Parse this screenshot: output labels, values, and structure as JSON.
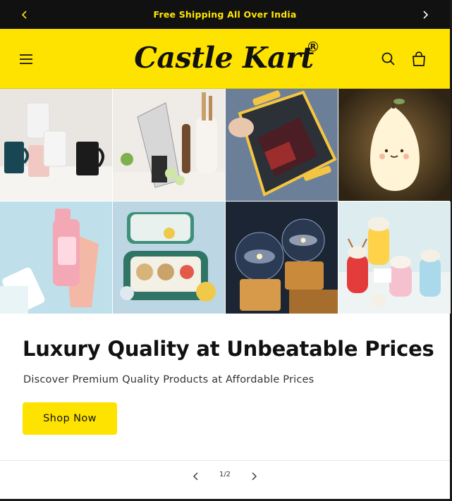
{
  "announcement": {
    "text": "Free Shipping All Over India",
    "prev_icon": "chevron-left-icon",
    "next_icon": "chevron-right-icon"
  },
  "header": {
    "logo_text": "Castle Kart",
    "logo_mark": "R",
    "menu_icon": "hamburger-menu-icon",
    "search_icon": "search-icon",
    "cart_icon": "shopping-bag-icon",
    "background": "#ffe300"
  },
  "hero": {
    "products": [
      {
        "name": "mugs-set"
      },
      {
        "name": "vegetable-slicer"
      },
      {
        "name": "lunch-box-dark"
      },
      {
        "name": "pear-night-lamp"
      },
      {
        "name": "water-bottle-pink"
      },
      {
        "name": "lunch-box-green"
      },
      {
        "name": "galaxy-crystal-ball"
      },
      {
        "name": "reindeer-bottles"
      }
    ],
    "title": "Luxury Quality at Unbeatable Prices",
    "subtitle": "Discover Premium Quality Products at Affordable Prices",
    "cta_label": "Shop Now",
    "accent": "#ffe300"
  },
  "slider": {
    "counter": "1/2",
    "prev_icon": "chevron-left-icon",
    "next_icon": "chevron-right-icon"
  }
}
